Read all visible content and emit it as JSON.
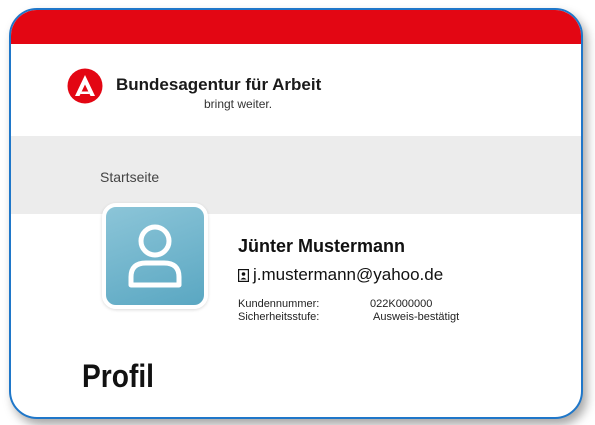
{
  "colors": {
    "brand_red": "#e30613",
    "frame_blue": "#1f77c9",
    "band_grey": "#ececec",
    "avatar_blue": "#6fb3cc"
  },
  "header": {
    "logo_icon": "ba-logo-icon",
    "brand_name": "Bundesagentur für Arbeit",
    "slogan": "bringt weiter."
  },
  "breadcrumb": {
    "home_label": "Startseite"
  },
  "profile": {
    "avatar_icon": "user-avatar-icon",
    "name": "Jünter Mustermann",
    "email_icon": "id-card-icon",
    "email": "j.mustermann@yahoo.de",
    "customer_number_label": "Kundennummer:",
    "customer_number_value": "022K000000",
    "security_level_label": "Sicherheitsstufe:",
    "security_level_value": "Ausweis-bestätigt"
  },
  "main": {
    "page_title": "Profil"
  }
}
